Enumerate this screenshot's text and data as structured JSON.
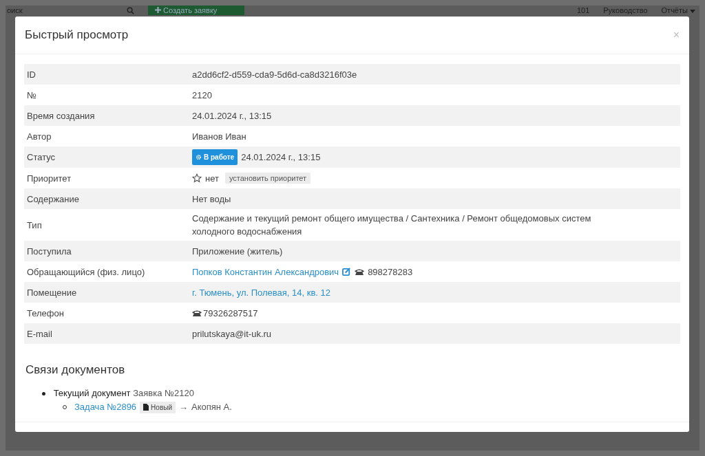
{
  "topbar": {
    "search": {
      "placeholder": "оиск"
    },
    "create_button": "Создать заявку",
    "phone": "101",
    "guide": "Руководство",
    "reports": "Отчёты"
  },
  "modal": {
    "title": "Быстрый просмотр",
    "close": "×",
    "fields": [
      {
        "kind": "text",
        "label": "ID",
        "value": "a2dd6cf2-d559-cda9-5d6d-ca8d3216f03e"
      },
      {
        "kind": "text",
        "label": "№",
        "value": "2120"
      },
      {
        "kind": "text",
        "label": "Время создания",
        "value": "24.01.2024 г., 13:15"
      },
      {
        "kind": "text",
        "label": "Автор",
        "value": "Иванов Иван"
      },
      {
        "kind": "status",
        "label": "Статус",
        "badge": "В работе",
        "value": "24.01.2024 г., 13:15"
      },
      {
        "kind": "priority",
        "label": "Приоритет",
        "value": "нет",
        "button": "установить приоритет"
      },
      {
        "kind": "text",
        "label": "Содержание",
        "value": "Нет воды"
      },
      {
        "kind": "text",
        "label": "Тип",
        "value": "Содержание и текущий ремонт общего имущества / Сантехника / Ремонт общедомовых систем холодного водоснабжения"
      },
      {
        "kind": "text",
        "label": "Поступила",
        "value": "Приложение (житель)"
      },
      {
        "kind": "person",
        "label": "Обращающийся (физ. лицо)",
        "value": "Попков Константин Александрович",
        "phone": "898278283"
      },
      {
        "kind": "link",
        "label": "Помещение",
        "value": "г. Тюмень, ул. Полевая, 14, кв. 12"
      },
      {
        "kind": "phone",
        "label": "Телефон",
        "value": "79326287517"
      },
      {
        "kind": "text",
        "label": "E-mail",
        "value": "prilutskaya@it-uk.ru"
      }
    ],
    "links": {
      "title": "Связи документов",
      "items": [
        {
          "label": "Текущий документ",
          "value": "Заявка №2120",
          "children": [
            {
              "link": "Задача №2896",
              "badge": "Новый",
              "arrow": "→",
              "assignee": "Акопян А."
            }
          ]
        }
      ]
    }
  }
}
